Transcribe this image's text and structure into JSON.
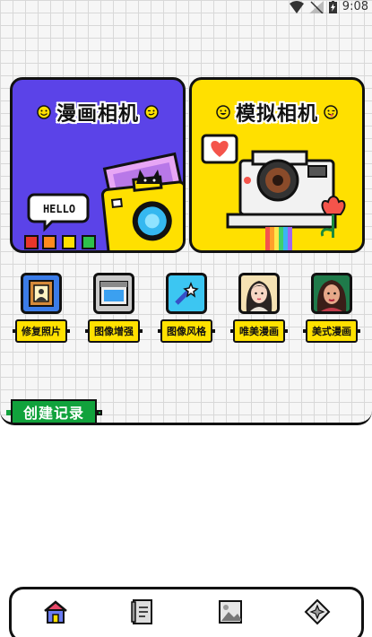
{
  "status_bar": {
    "time": "9:08"
  },
  "cards": {
    "comic": {
      "title": "漫画相机",
      "bubble": "HELLO",
      "color": "#5b43e8"
    },
    "analog": {
      "title": "模拟相机",
      "color": "#ffe000"
    }
  },
  "tools": [
    {
      "label": "修复照片",
      "icon": "portrait-frame-icon"
    },
    {
      "label": "图像增强",
      "icon": "screen-enhance-icon"
    },
    {
      "label": "图像风格",
      "icon": "magic-wand-icon"
    },
    {
      "label": "唯美漫画",
      "icon": "anime-girl-icon"
    },
    {
      "label": "美式漫画",
      "icon": "comic-girl-icon"
    }
  ],
  "record": {
    "label": "创建记录"
  },
  "bottom_nav": [
    {
      "icon": "home-icon"
    },
    {
      "icon": "album-icon"
    },
    {
      "icon": "gallery-icon"
    },
    {
      "icon": "discover-icon"
    }
  ],
  "colors": {
    "accent_yellow": "#ffe100",
    "record_green": "#11a23c",
    "purple": "#5b43e8"
  }
}
